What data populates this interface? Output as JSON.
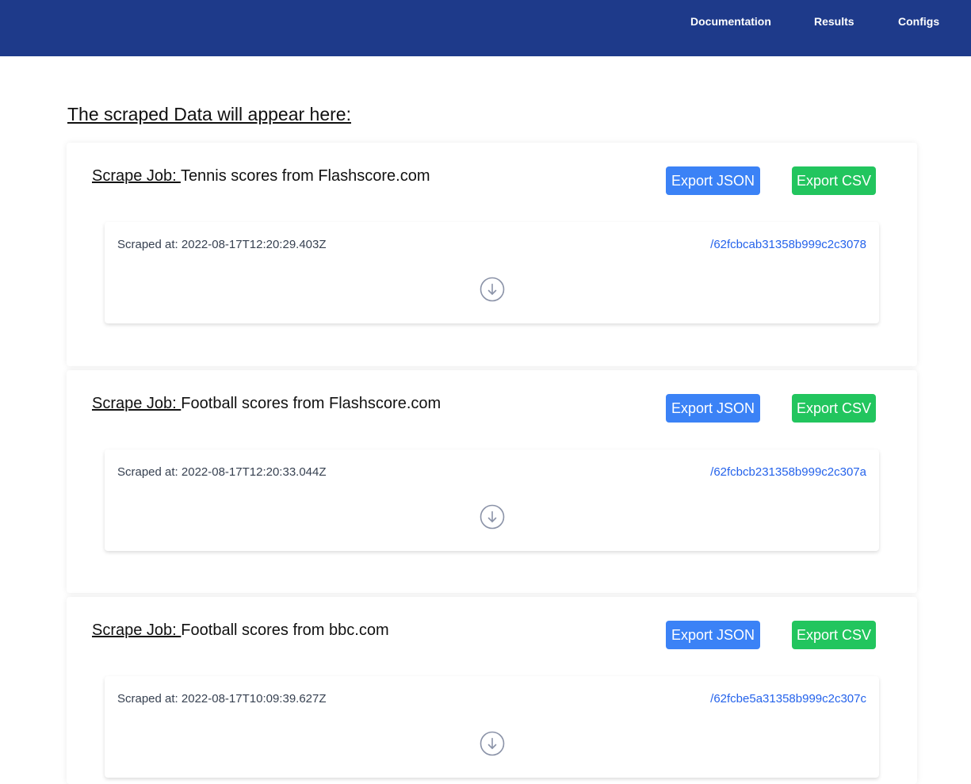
{
  "nav": {
    "documentation": "Documentation",
    "results": "Results",
    "configs": "Configs"
  },
  "page": {
    "heading": "The scraped Data will appear here:"
  },
  "jobs": [
    {
      "prefix": "Scrape Job: ",
      "name": "Tennis scores from Flashscore.com",
      "export_json": "Export JSON",
      "export_csv": "Export CSV",
      "result": {
        "scraped_at": "Scraped at: 2022-08-17T12:20:29.403Z",
        "link": "/62fcbcab31358b999c2c3078",
        "icon": "arrow-down-circle-icon"
      }
    },
    {
      "prefix": "Scrape Job: ",
      "name": "Football scores from Flashscore.com",
      "export_json": "Export JSON",
      "export_csv": "Export CSV",
      "result": {
        "scraped_at": "Scraped at: 2022-08-17T12:20:33.044Z",
        "link": "/62fcbcb231358b999c2c307a",
        "icon": "arrow-down-circle-icon"
      }
    },
    {
      "prefix": "Scrape Job: ",
      "name": "Football scores from bbc.com",
      "export_json": "Export JSON",
      "export_csv": "Export CSV",
      "result": {
        "scraped_at": "Scraped at: 2022-08-17T10:09:39.627Z",
        "link": "/62fcbe5a31358b999c2c307c",
        "icon": "arrow-down-circle-icon"
      }
    }
  ],
  "colors": {
    "navbar": "#1e3a8a",
    "export_json": "#3b82f6",
    "export_csv": "#22c55e",
    "link": "#2563eb"
  }
}
